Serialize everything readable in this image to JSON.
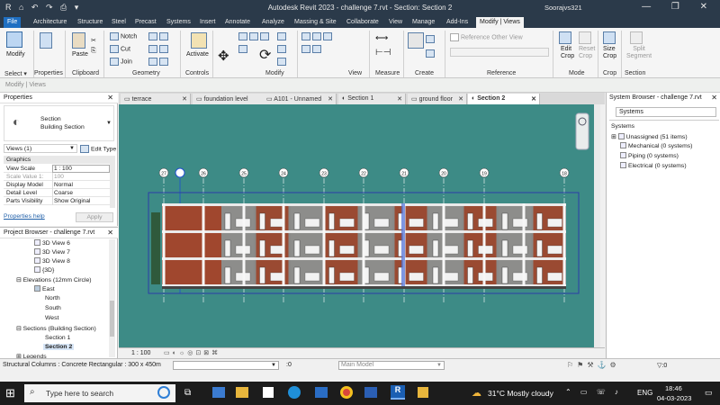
{
  "titlebar": {
    "title": "Autodesk Revit 2023 - challenge 7.rvt - Section: Section 2",
    "user": "Soorajvs321",
    "qat_glyphs": "R ⌂ ↶ ↷ ⎙ ▾",
    "window_controls": "— ❐ ✕"
  },
  "tabs": [
    "File",
    "Architecture",
    "Structure",
    "Steel",
    "Precast",
    "Systems",
    "Insert",
    "Annotate",
    "Analyze",
    "Massing & Site",
    "Collaborate",
    "View",
    "Manage",
    "Add-Ins",
    "Modify | Views"
  ],
  "ribbon": {
    "modify": "Modify",
    "paste": "Paste",
    "notch": "Notch",
    "cut": "Cut",
    "join": "Join",
    "activate": "Activate",
    "ref_other": "Reference Other View",
    "edit_crop": [
      "Edit",
      "Crop"
    ],
    "reset_crop": [
      "Reset",
      "Crop"
    ],
    "size_crop": [
      "Size",
      "Crop"
    ],
    "split_segment": [
      "Split",
      "Segment"
    ],
    "groups": [
      "Select ▾",
      "Properties",
      "Clipboard",
      "Geometry",
      "Controls",
      "Modify",
      "View",
      "Measure",
      "Create",
      "Reference",
      "Mode",
      "Crop",
      "Section"
    ]
  },
  "optbar": {
    "text": "Modify | Views"
  },
  "properties": {
    "title": "Properties",
    "type_line1": "Section",
    "type_line2": "Building Section",
    "views_selector": "Views (1)",
    "edit_type": "Edit Type",
    "section_header": "Graphics",
    "rows": [
      {
        "k": "View Scale",
        "v": "1 : 100"
      },
      {
        "k": "Scale Value 1:",
        "v": "100"
      },
      {
        "k": "Display Model",
        "v": "Normal"
      },
      {
        "k": "Detail Level",
        "v": "Coarse"
      },
      {
        "k": "Parts Visibility",
        "v": "Show Original"
      }
    ],
    "help": "Properties help",
    "apply": "Apply"
  },
  "project_browser": {
    "title": "Project Browser - challenge 7.rvt",
    "items": [
      "3D View 6",
      "3D View 7",
      "3D View 8",
      "{3D}",
      "Elevations (12mm Circle)",
      "East",
      "North",
      "South",
      "West",
      "Sections (Building Section)",
      "Section 1",
      "Section 2",
      "Legends"
    ]
  },
  "view_tabs": [
    "terrace",
    "foundation level",
    "A101 - Unnamed",
    "Section 1",
    "ground floor",
    "Section 2"
  ],
  "view_bar": {
    "scale": "1 : 100"
  },
  "grid_labels": [
    "27",
    "26",
    "25",
    "24",
    "23",
    "22",
    "21",
    "20",
    "19",
    "18"
  ],
  "system_browser": {
    "title": "System Browser - challenge 7.rvt",
    "filter": "Systems",
    "header": "Systems",
    "items": [
      "Unassigned (51 items)",
      "Mechanical (0 systems)",
      "Piping (0 systems)",
      "Electrical (0 systems)"
    ]
  },
  "status": {
    "left": "Structural Columns : Concrete Rectangular : 300 x 450m",
    "zero": ":0",
    "model": "Main Model",
    "filter_count": ":0"
  },
  "taskbar": {
    "search": "Type here to search",
    "weather": "31°C  Mostly cloudy",
    "lang": "ENG",
    "time": "18:46",
    "date": "04-03-2023"
  },
  "colors": {
    "canvas": "#3d8b86",
    "brick": "#a0472e",
    "accent": "#1f6fc2"
  }
}
